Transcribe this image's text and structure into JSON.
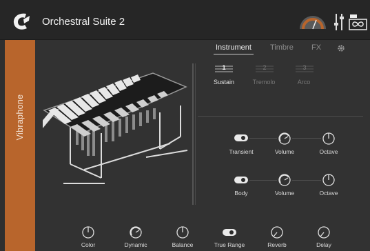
{
  "header": {
    "title": "Orchestral Suite 2"
  },
  "sidebar": {
    "instrument_name": "Vibraphone"
  },
  "tabs": [
    {
      "label": "Instrument",
      "active": true
    },
    {
      "label": "Timbre",
      "active": false
    },
    {
      "label": "FX",
      "active": false
    }
  ],
  "articulations": [
    {
      "number": "1",
      "label": "Sustain",
      "active": true
    },
    {
      "number": "2",
      "label": "Tremolo",
      "active": false
    },
    {
      "number": "3",
      "label": "Arco",
      "active": false
    }
  ],
  "transient": {
    "toggle_label": "Transient",
    "volume_label": "Volume",
    "octave_label": "Octave",
    "enabled": true
  },
  "body": {
    "toggle_label": "Body",
    "volume_label": "Volume",
    "octave_label": "Octave",
    "enabled": true
  },
  "bottom_controls": [
    {
      "label": "Color"
    },
    {
      "label": "Dynamic"
    },
    {
      "label": "Balance"
    },
    {
      "label": "True Range"
    },
    {
      "label": "Reverb"
    },
    {
      "label": "Delay"
    }
  ],
  "colors": {
    "accent": "#b8652c",
    "background": "#2f2f2f",
    "header": "#262626"
  },
  "icons": [
    "app-logo-icon",
    "gauge-meter-icon",
    "mixer-sliders-icon",
    "uvi-logo-icon",
    "gear-icon"
  ]
}
